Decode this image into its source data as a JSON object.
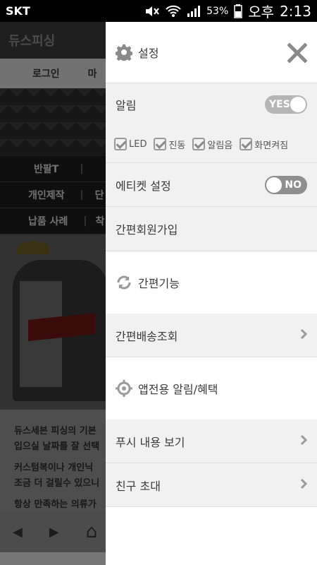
{
  "status_bar": {
    "carrier": "SKT",
    "battery": "53%",
    "ampm": "오후",
    "time": "2:13"
  },
  "background_app": {
    "title": "듀스피싱",
    "login": "로그인",
    "login_next": "마",
    "menu_rows": [
      "반팔T",
      "개인제작",
      "납품 사례"
    ],
    "menu_right": [
      "",
      "단",
      "착"
    ],
    "text_lines": [
      "듀스세븐 피싱의 기본",
      "입으실 날짜를 잘 선택",
      "커스텀복이나 개인닉",
      "조금 더 걸릴수 있으니",
      "항상 만족하는 의류가"
    ],
    "nav_back": "◀",
    "nav_forward": "▶",
    "nav_home": "⌂"
  },
  "drawer": {
    "settings_label": "설정",
    "close_icon": "close-icon",
    "notifications_label": "알림",
    "notifications_toggle": "YES",
    "options": [
      "LED",
      "진동",
      "알림음",
      "화면켜짐"
    ],
    "etiquette_label": "에티켓 설정",
    "etiquette_toggle": "NO",
    "signup_label": "간편회원가입",
    "quick_label": "간편기능",
    "delivery_label": "간편배송조회",
    "app_alert_label": "앱전용 알림/혜택",
    "push_label": "푸시 내용 보기",
    "invite_label": "친구 초대"
  }
}
